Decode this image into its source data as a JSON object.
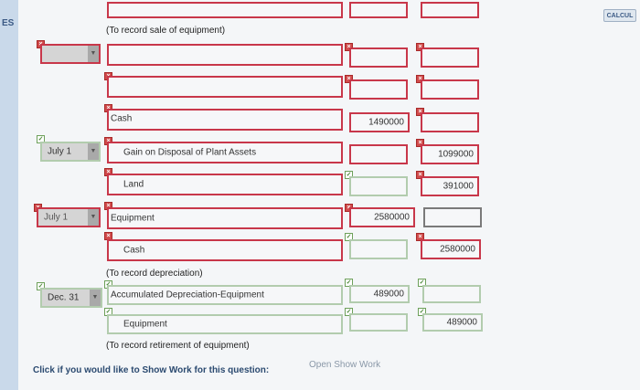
{
  "sidebar": {
    "label": "ES"
  },
  "header": {
    "calculator_label": "CALCUL"
  },
  "notes": {
    "sale": "(To record sale of equipment)",
    "depreciation": "(To record depreciation)",
    "retirement": "(To record retirement of equipment)"
  },
  "rows": {
    "r3": {
      "account": "Cash",
      "debit": "1490000"
    },
    "r4": {
      "date": "July 1",
      "account": "Gain on Disposal of Plant Assets",
      "credit": "1099000"
    },
    "r5": {
      "account": "Land",
      "credit": "391000"
    },
    "r6": {
      "date": "July 1",
      "account": "Equipment",
      "debit": "2580000"
    },
    "r7": {
      "account": "Cash",
      "credit": "2580000"
    },
    "r8": {
      "date": "Dec. 31",
      "account": "Accumulated Depreciation-Equipment",
      "debit": "489000"
    },
    "r9": {
      "account": "Equipment",
      "credit": "489000"
    }
  },
  "footer": {
    "prompt": "Click if you would like to Show Work for this question:",
    "link": "Open Show Work"
  },
  "colors": {
    "error": "#c8374a",
    "correct": "#b2ccae",
    "link": "#2b4a70"
  }
}
